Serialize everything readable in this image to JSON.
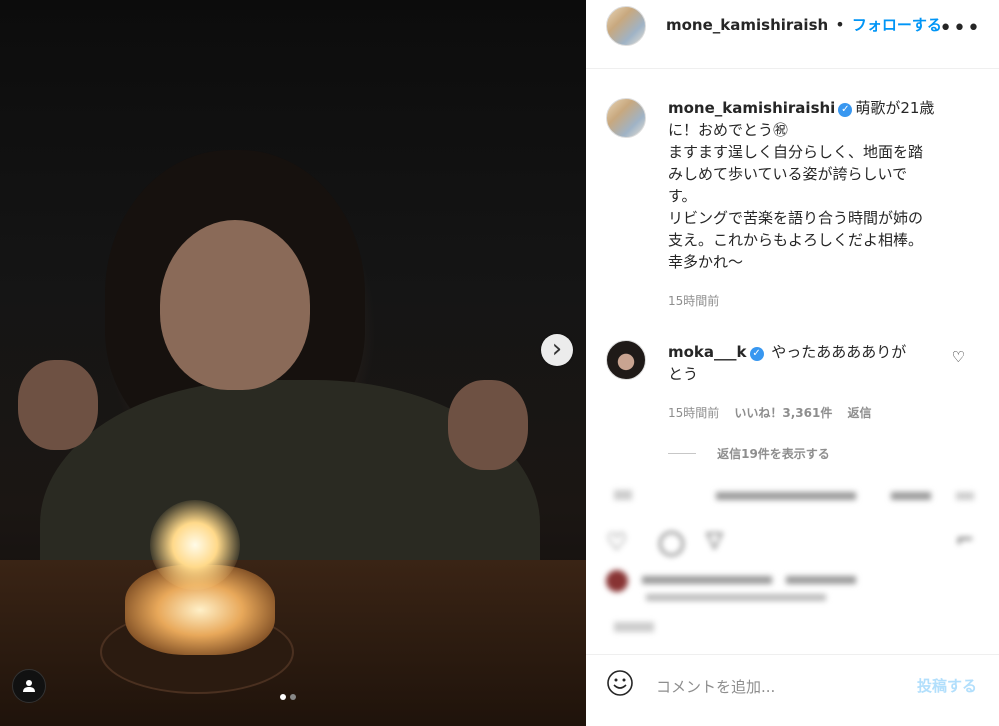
{
  "post": {
    "username": "mone_kamishiraish",
    "follow_label": "フォローする",
    "separator": "•",
    "more_label": "•••"
  },
  "caption": {
    "username": "mone_kamishiraishi",
    "lines": [
      "萌歌が21歳",
      "に！おめでとう㊗",
      "ますます逞しく自分らしく、地面を踏",
      "みしめて歩いている姿が誇らしいで",
      "す。",
      "リビングで苦楽を語り合う時間が姉の",
      "支え。これからもよろしくだよ相棒。",
      "幸多かれ〜"
    ],
    "time": "15時間前"
  },
  "comment": {
    "username": "moka___k",
    "text_line1": "やったあああありが",
    "text_line2": "とう",
    "time": "15時間前",
    "likes": "いいね！3,361件",
    "reply": "返信",
    "view_replies": "返信19件を表示する"
  },
  "composer": {
    "placeholder": "コメントを追加...",
    "post_label": "投稿する"
  },
  "carousel": {
    "total_images": 2,
    "current_index": 1
  },
  "colors": {
    "accent": "#0095f6",
    "post_disabled": "#b2dffc",
    "verified": "#3897f0"
  },
  "icons": [
    "chevron-right-icon",
    "person-tag-icon",
    "verified-icon",
    "heart-icon",
    "more-icon",
    "emoji-icon",
    "comment-icon",
    "share-icon",
    "bookmark-icon"
  ]
}
